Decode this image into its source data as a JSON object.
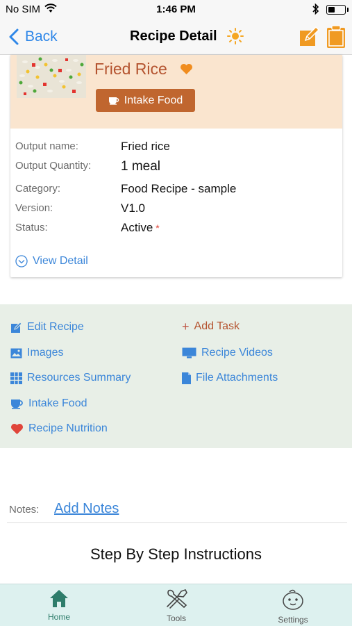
{
  "status_bar": {
    "carrier": "No SIM",
    "time": "1:46 PM"
  },
  "nav": {
    "back_label": "Back",
    "title": "Recipe Detail"
  },
  "recipe": {
    "name": "Fried Rice",
    "intake_button_label": "Intake Food",
    "details": [
      {
        "label": "Output name:",
        "value": "Fried rice"
      },
      {
        "label": "Output Quantity:",
        "value": "1 meal"
      },
      {
        "label": "Category:",
        "value": "Food Recipe - sample"
      },
      {
        "label": "Version:",
        "value": "V1.0"
      },
      {
        "label": "Status:",
        "value": "Active",
        "required_mark": "*"
      }
    ],
    "view_detail_label": "View Detail"
  },
  "actions": {
    "edit_recipe": "Edit Recipe",
    "add_task": "Add Task",
    "images": "Images",
    "recipe_videos": "Recipe Videos",
    "resources_summary": "Resources Summary",
    "file_attachments": "File Attachments",
    "intake_food": "Intake Food",
    "recipe_nutrition": "Recipe Nutrition"
  },
  "notes": {
    "label": "Notes:",
    "link": "Add Notes"
  },
  "steps_title": "Step By Step Instructions",
  "tabs": [
    {
      "label": "Home",
      "icon": "home-icon",
      "active": true
    },
    {
      "label": "Tools",
      "icon": "tools-icon",
      "active": false
    },
    {
      "label": "Settings",
      "icon": "settings-face-icon",
      "active": false
    }
  ],
  "colors": {
    "accent_blue": "#3b86d9",
    "brand_orange": "#c0662f",
    "header_bg": "#fae5cf",
    "panel_bg": "#e8efe7",
    "tabbar_bg": "#ddf1ef",
    "favorite": "#f08c1e"
  }
}
